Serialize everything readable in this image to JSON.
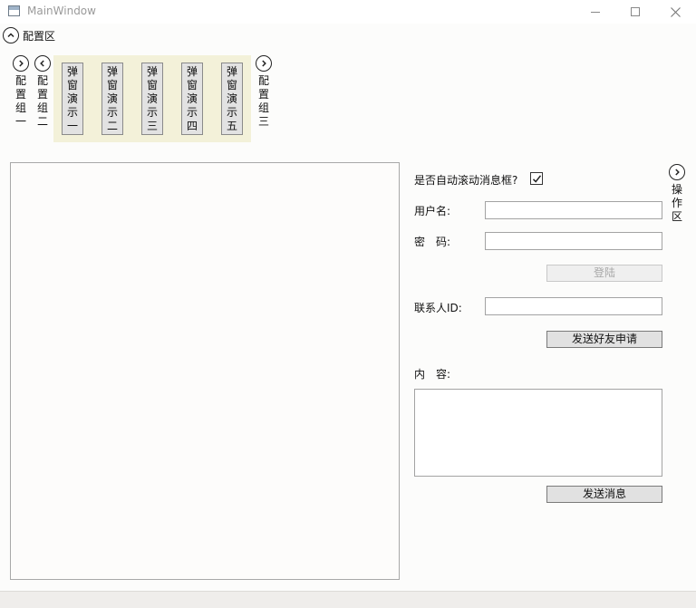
{
  "window": {
    "title": "MainWindow",
    "controls": {
      "minimize": "minimize-icon",
      "maximize": "maximize-icon",
      "close": "close-icon"
    }
  },
  "config_area": {
    "label": "配置区",
    "group1_label": "配置组一",
    "group2_label": "配置组二",
    "group3_label": "配置组三",
    "demo_buttons": [
      "弹窗演示一",
      "弹窗演示二",
      "弹窗演示三",
      "弹窗演示四",
      "弹窗演示五"
    ]
  },
  "operation_area": {
    "label": "操作区",
    "auto_scroll_label": "是否自动滚动消息框?",
    "auto_scroll_checked": true,
    "username_label": "用户名:",
    "username_value": "",
    "password_label": "密　码:",
    "password_value": "",
    "login_button": "登陆",
    "contact_id_label": "联系人ID:",
    "contact_id_value": "",
    "send_friend_request_button": "发送好友申请",
    "content_label": "内　容:",
    "content_value": "",
    "send_message_button": "发送消息"
  },
  "log_area": {
    "text": ""
  },
  "colors": {
    "demo_strip_bg": "#f3f1d9",
    "button_bg": "#e1e1e1",
    "border": "#a3a3a3"
  }
}
